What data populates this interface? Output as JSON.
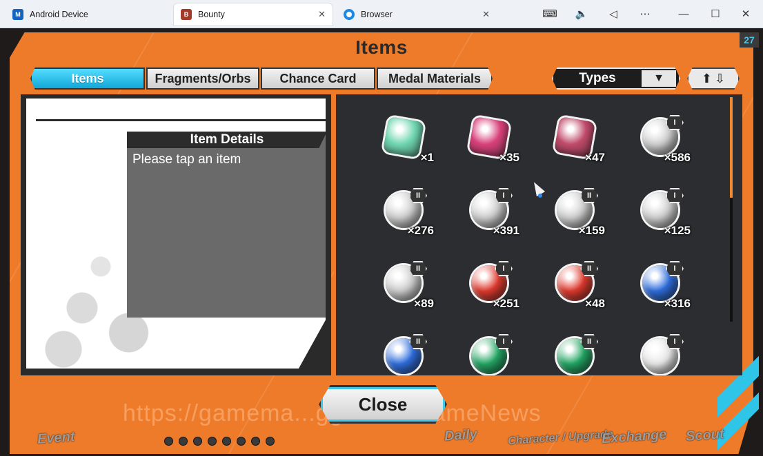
{
  "browser_tabs": [
    {
      "label": "Android Device",
      "icon": "android-device-icon",
      "active": false
    },
    {
      "label": "Bounty",
      "icon": "bounty-game-icon",
      "active": true
    },
    {
      "label": "Browser",
      "icon": "browser-icon",
      "active": false
    }
  ],
  "window_controls": {
    "keyboard": "keyboard-icon",
    "volume": "volume-icon",
    "back": "back-icon",
    "more": "more-icon",
    "minimize": "minimize-icon",
    "maximize": "maximize-icon",
    "close": "close-icon"
  },
  "game": {
    "level_badge": "27",
    "panel_title": "Items",
    "categories": [
      {
        "label": "Items",
        "active": true
      },
      {
        "label": "Fragments/Orbs",
        "active": false
      },
      {
        "label": "Chance Card",
        "active": false
      },
      {
        "label": "Medal Materials",
        "active": false
      }
    ],
    "types_filter": "Types",
    "details": {
      "title": "Item Details",
      "text": "Please tap an item"
    },
    "items": [
      {
        "name": "hex-100-token",
        "count": "×1",
        "rank": "",
        "color": "#6fd6b0"
      },
      {
        "name": "pink-fist-medal",
        "count": "×35",
        "rank": "",
        "color": "#d8407a"
      },
      {
        "name": "pink-blue-hex-medal",
        "count": "×47",
        "rank": "",
        "color": "#c04a6a"
      },
      {
        "name": "silver-fist-medal",
        "count": "×586",
        "rank": "I",
        "color": "#cfcfcf"
      },
      {
        "name": "silver-fist-medal",
        "count": "×276",
        "rank": "II",
        "color": "#cfcfcf"
      },
      {
        "name": "silver-shield-medal",
        "count": "×391",
        "rank": "I",
        "color": "#cfcfcf"
      },
      {
        "name": "silver-shield-medal",
        "count": "×159",
        "rank": "II",
        "color": "#cfcfcf"
      },
      {
        "name": "silver-boot-medal",
        "count": "×125",
        "rank": "I",
        "color": "#cfcfcf"
      },
      {
        "name": "silver-boot-medal",
        "count": "×89",
        "rank": "II",
        "color": "#cfcfcf"
      },
      {
        "name": "red-orb",
        "count": "×251",
        "rank": "I",
        "color": "#e23b2f"
      },
      {
        "name": "red-orb",
        "count": "×48",
        "rank": "II",
        "color": "#e23b2f"
      },
      {
        "name": "blue-orb",
        "count": "×316",
        "rank": "I",
        "color": "#2f6fe0"
      },
      {
        "name": "blue-orb",
        "count": "",
        "rank": "II",
        "color": "#2f6fe0"
      },
      {
        "name": "green-orb",
        "count": "",
        "rank": "I",
        "color": "#23a865"
      },
      {
        "name": "green-orb",
        "count": "",
        "rank": "II",
        "color": "#23a865"
      },
      {
        "name": "white-orb",
        "count": "",
        "rank": "I",
        "color": "#e8e8e8"
      }
    ],
    "close_label": "Close",
    "watermark": "https://gamema...gg/...ller/GameNews",
    "nav": [
      "Event",
      "Daily",
      "Character / Upgrade",
      "Exchange",
      "Scout"
    ]
  },
  "colors": {
    "frame_orange": "#ee7b2a",
    "accent_cyan": "#2ec5e8",
    "panel_dark": "#2b2d30"
  }
}
